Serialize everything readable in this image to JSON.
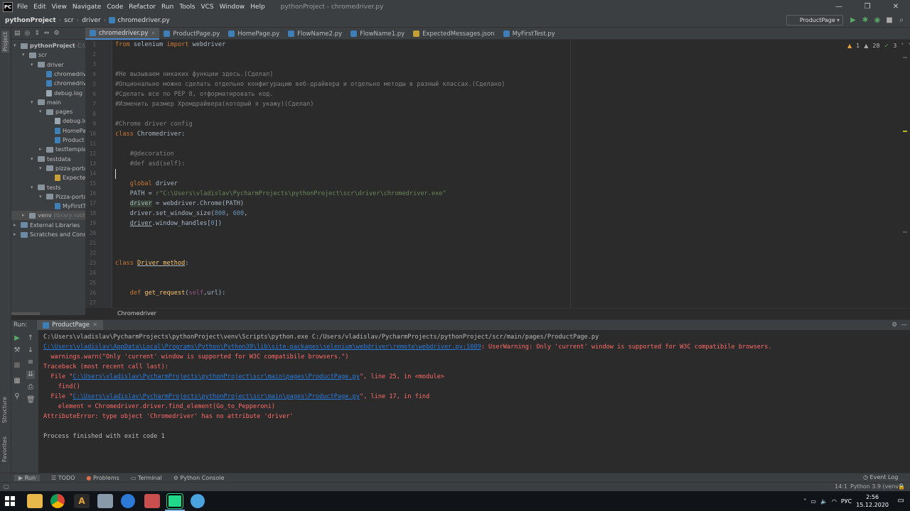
{
  "titlebar": {
    "logo": "PC",
    "menu": [
      "File",
      "Edit",
      "View",
      "Navigate",
      "Code",
      "Refactor",
      "Run",
      "Tools",
      "VCS",
      "Window",
      "Help"
    ],
    "window_title": "pythonProject - chromedriver.py",
    "controls": [
      "—",
      "❐",
      "✕"
    ]
  },
  "navbar": {
    "crumbs": [
      "pythonProject",
      "scr",
      "driver",
      "chromedriver.py"
    ],
    "run_config": "ProductPage"
  },
  "tabs": [
    "chromedriver.py",
    "ProductPage.py",
    "HomePage.py",
    "FlowName2.py",
    "FlowName1.py",
    "ExpectedMessages.json",
    "MyFirstTest.py"
  ],
  "tree": [
    {
      "label": "pythonProject",
      "suffix": "C:\\Us",
      "depth": 0,
      "kind": "folder",
      "open": true,
      "bold": true
    },
    {
      "label": "scr",
      "depth": 1,
      "kind": "folder",
      "open": true
    },
    {
      "label": "driver",
      "depth": 2,
      "kind": "folder",
      "open": true
    },
    {
      "label": "chromedriv",
      "depth": 3,
      "kind": "py"
    },
    {
      "label": "chromedriv",
      "depth": 3,
      "kind": "py"
    },
    {
      "label": "debug.log",
      "depth": 3,
      "kind": "log"
    },
    {
      "label": "main",
      "depth": 2,
      "kind": "folder",
      "open": true
    },
    {
      "label": "pages",
      "depth": 3,
      "kind": "folder",
      "open": true
    },
    {
      "label": "debug.lo",
      "depth": 4,
      "kind": "log"
    },
    {
      "label": "HomePa",
      "depth": 4,
      "kind": "py"
    },
    {
      "label": "Product",
      "depth": 4,
      "kind": "py"
    },
    {
      "label": "testtemplat",
      "depth": 3,
      "kind": "folder",
      "open": false
    },
    {
      "label": "testdata",
      "depth": 2,
      "kind": "folder",
      "open": true
    },
    {
      "label": "pizza-portal",
      "depth": 3,
      "kind": "folder",
      "open": true
    },
    {
      "label": "Expecte",
      "depth": 4,
      "kind": "json"
    },
    {
      "label": "tests",
      "depth": 2,
      "kind": "folder",
      "open": true
    },
    {
      "label": "Pizza-portal",
      "depth": 3,
      "kind": "folder",
      "open": true
    },
    {
      "label": "MyFirstT",
      "depth": 4,
      "kind": "py"
    },
    {
      "label": "venv",
      "suffix": "library root",
      "depth": 1,
      "kind": "folder",
      "open": false,
      "selected": true
    },
    {
      "label": "External Libraries",
      "depth": 0,
      "kind": "lib",
      "open": false
    },
    {
      "label": "Scratches and Console",
      "depth": 0,
      "kind": "lib",
      "open": false
    }
  ],
  "inspections": {
    "warnings": "1",
    "weak": "28",
    "ok": "3"
  },
  "line_numbers": [
    "1",
    "2",
    "3",
    "4",
    "5",
    "6",
    "7",
    "8",
    "9",
    "10",
    "11",
    "12",
    "13",
    "14",
    "15",
    "16",
    "17",
    "18",
    "19",
    "20",
    "21",
    "22",
    "23",
    "24",
    "25",
    "26",
    "27"
  ],
  "code": [
    [
      [
        "kw",
        "from"
      ],
      [
        "gv",
        " selenium "
      ],
      [
        "kw",
        "import"
      ],
      [
        "gv",
        " webdriver"
      ]
    ],
    [],
    [],
    [
      [
        "cm",
        "#Не вызываем никаких функции здесь.(Сделал)"
      ]
    ],
    [
      [
        "cm",
        "#Опционально можно сделать отдельно конфигурацию веб-драйвера и отдельно методы в разный классах.(Сделано)"
      ]
    ],
    [
      [
        "cm",
        "#Сделать все по PEP 8, отформатировать код."
      ]
    ],
    [
      [
        "cm",
        "#Изменить размер Хромдрайвера(который я укажу)(Сделал)"
      ]
    ],
    [],
    [
      [
        "cm",
        "#Chrome driver config"
      ]
    ],
    [
      [
        "kw",
        "class "
      ],
      [
        "gv",
        "Chromedriver:"
      ]
    ],
    [],
    [
      [
        "cm",
        "    #@decoration"
      ]
    ],
    [
      [
        "cm",
        "    #def asd(self):"
      ]
    ],
    [],
    [
      [
        "kw",
        "    global "
      ],
      [
        "gv",
        "driver"
      ]
    ],
    [
      [
        "gv",
        "    PATH = "
      ],
      [
        "str",
        "r\"C:\\Users\\vladislav\\PycharmProjects\\pythonProject\\scr\\driver\\chromedriver.exe\""
      ]
    ],
    [
      [
        "gv",
        "    "
      ],
      [
        "hl",
        "driver"
      ],
      [
        "gv",
        " = webdriver.Chrome(PATH)"
      ]
    ],
    [
      [
        "gv",
        "    driver.set_window_size("
      ],
      [
        "num",
        "800"
      ],
      [
        "gv",
        ", "
      ],
      [
        "num",
        "600"
      ],
      [
        "gv",
        ","
      ]
    ],
    [
      [
        "gv",
        "    "
      ],
      [
        "ul",
        "driver"
      ],
      [
        "gv",
        ".window_handles["
      ],
      [
        "num",
        "0"
      ],
      [
        "gv",
        "])"
      ]
    ],
    [],
    [],
    [],
    [
      [
        "kw",
        "class "
      ],
      [
        "fn",
        "Driver_method"
      ],
      [
        "gv",
        ":"
      ]
    ],
    [],
    [],
    [
      [
        "kw",
        "    def "
      ],
      [
        "fn",
        "get_request"
      ],
      [
        "gv",
        "("
      ],
      [
        "slf",
        "self"
      ],
      [
        "gv",
        ",url):"
      ]
    ],
    []
  ],
  "editor_breadcrumb": "Chromedriver",
  "run": {
    "label": "Run:",
    "tab": "ProductPage"
  },
  "console": [
    [
      [
        "c-n",
        "C:\\Users\\vladislav\\PycharmProjects\\pythonProject\\venv\\Scripts\\python.exe C:/Users/vladislav/PycharmProjects/pythonProject/scr/main/pages/ProductPage.py"
      ]
    ],
    [
      [
        "c-l",
        "C:\\Users\\vladislav\\AppData\\Local\\Programs\\Python\\Python39\\lib\\site-packages\\selenium\\webdriver\\remote\\webdriver.py:1089"
      ],
      [
        "c-e",
        ": UserWarning: Only 'current' window is supported for W3C compatibile browsers."
      ]
    ],
    [
      [
        "c-e",
        "  warnings.warn(\"Only 'current' window is supported for W3C compatibile browsers.\")"
      ]
    ],
    [
      [
        "c-e",
        "Traceback (most recent call last):"
      ]
    ],
    [
      [
        "c-e",
        "  File \""
      ],
      [
        "c-l",
        "C:\\Users\\vladislav\\PycharmProjects\\pythonProject\\scr\\main\\pages\\ProductPage.py"
      ],
      [
        "c-e",
        "\", line 25, in <module>"
      ]
    ],
    [
      [
        "c-e",
        "    find()"
      ]
    ],
    [
      [
        "c-e",
        "  File \""
      ],
      [
        "c-l",
        "C:\\Users\\vladislav\\PycharmProjects\\pythonProject\\scr\\main\\pages\\ProductPage.py"
      ],
      [
        "c-e",
        "\", line 17, in find"
      ]
    ],
    [
      [
        "c-e",
        "    element = Chromedriver.driver.find_element(Go_to_Pepperoni)"
      ]
    ],
    [
      [
        "c-e",
        "AttributeError: type object 'Chromedriver' has no attribute 'driver'"
      ]
    ],
    [],
    [
      [
        "c-n",
        "Process finished with exit code 1"
      ]
    ]
  ],
  "bottom_tools": [
    "Run",
    "TODO",
    "Problems",
    "Terminal",
    "Python Console"
  ],
  "event_log": "Event Log",
  "status": {
    "position": "14:1",
    "interpreter": "Python 3.9 (venv)"
  },
  "taskbar": {
    "lang": "РУС",
    "time": "2:56",
    "date": "15.12.2020"
  },
  "side_labels": {
    "project": "Project",
    "structure": "Structure",
    "favorites": "Favorites"
  }
}
